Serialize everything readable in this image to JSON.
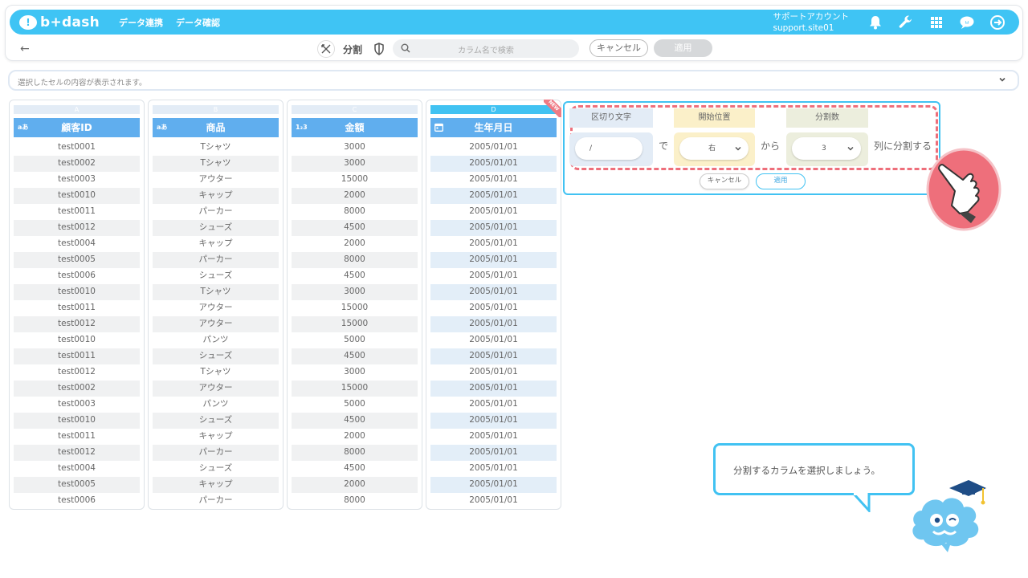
{
  "header": {
    "logo_text": "b+dash",
    "nav": [
      "データ連携",
      "データ確認"
    ],
    "account_label": "サポートアカウント",
    "account_id": "support.site01",
    "icons": [
      "bell-icon",
      "wrench-icon",
      "grid-icon",
      "chat-icon",
      "logout-icon"
    ]
  },
  "toolbar": {
    "back_icon": "←",
    "mode_label": "分割",
    "search_placeholder": "カラム名で検索",
    "cancel_label": "キャンセル",
    "apply_label": "適用"
  },
  "cell_bar": {
    "text": "選択したセルの内容が表示されます。"
  },
  "columns": [
    {
      "letter": "A",
      "type_icon": "aあ",
      "title": "顧客ID",
      "values": [
        "test0001",
        "test0002",
        "test0003",
        "test0010",
        "test0011",
        "test0012",
        "test0004",
        "test0005",
        "test0006",
        "test0010",
        "test0011",
        "test0012",
        "test0010",
        "test0011",
        "test0012",
        "test0002",
        "test0003",
        "test0010",
        "test0011",
        "test0012",
        "test0004",
        "test0005",
        "test0006"
      ]
    },
    {
      "letter": "B",
      "type_icon": "aあ",
      "title": "商品",
      "values": [
        "Tシャツ",
        "Tシャツ",
        "アウター",
        "キャップ",
        "パーカー",
        "シューズ",
        "キャップ",
        "パーカー",
        "シューズ",
        "Tシャツ",
        "アウター",
        "アウター",
        "パンツ",
        "シューズ",
        "Tシャツ",
        "アウター",
        "パンツ",
        "シューズ",
        "キャップ",
        "パーカー",
        "シューズ",
        "キャップ",
        "パーカー"
      ]
    },
    {
      "letter": "C",
      "type_icon": "1₂3",
      "title": "金額",
      "values": [
        "3000",
        "3000",
        "15000",
        "2000",
        "8000",
        "4500",
        "2000",
        "8000",
        "4500",
        "3000",
        "15000",
        "15000",
        "5000",
        "4500",
        "3000",
        "15000",
        "5000",
        "4500",
        "2000",
        "8000",
        "4500",
        "2000",
        "8000"
      ]
    },
    {
      "letter": "D",
      "type_icon": "calendar-icon",
      "title": "生年月日",
      "new_badge": "NEW",
      "values": [
        "2005/01/01",
        "2005/01/01",
        "2005/01/01",
        "2005/01/01",
        "2005/01/01",
        "2005/01/01",
        "2005/01/01",
        "2005/01/01",
        "2005/01/01",
        "2005/01/01",
        "2005/01/01",
        "2005/01/01",
        "2005/01/01",
        "2005/01/01",
        "2005/01/01",
        "2005/01/01",
        "2005/01/01",
        "2005/01/01",
        "2005/01/01",
        "2005/01/01",
        "2005/01/01",
        "2005/01/01",
        "2005/01/01"
      ]
    }
  ],
  "split_panel": {
    "delimiter_label": "区切り文字",
    "delimiter_value": "/",
    "connector_de": "で",
    "start_label": "開始位置",
    "start_value": "右",
    "connector_kara": "から",
    "count_label": "分割数",
    "count_value": "3",
    "suffix": "列に分割する",
    "cancel_label": "キャンセル",
    "apply_label": "適用"
  },
  "guide": {
    "bubble_text": "分割するカラムを選択しましょう。"
  },
  "colors": {
    "brand": "#3fc4f4",
    "header_cell": "#60aeee",
    "highlight": "#ee6f7b",
    "delimiter_bg": "#e3ecf6",
    "start_bg": "#fbf0c9",
    "count_bg": "#eceedd"
  }
}
